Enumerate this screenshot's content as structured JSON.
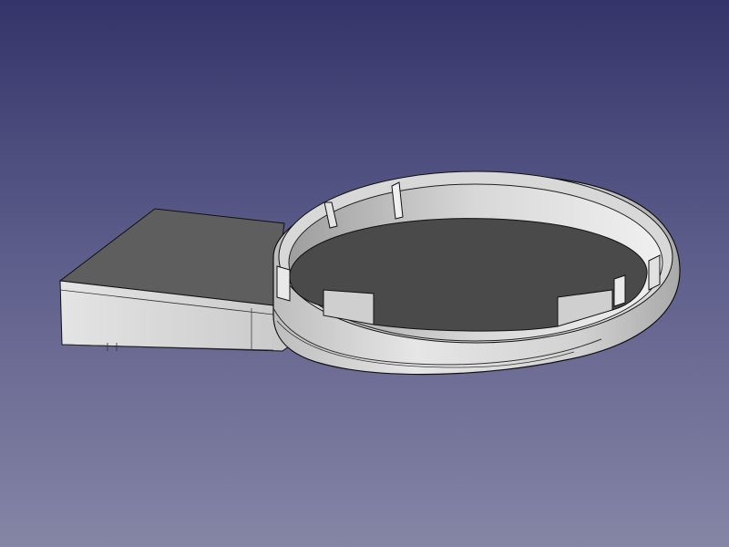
{
  "view": {
    "background_top": "#34346a",
    "background_bottom": "#8585a6"
  },
  "model": {
    "shape": "round dish with tab",
    "body_color": "#d0d0d0",
    "shadow_color": "#5e5e5e",
    "dark_face_color": "#4a4a4a",
    "edge_color": "#000000"
  }
}
